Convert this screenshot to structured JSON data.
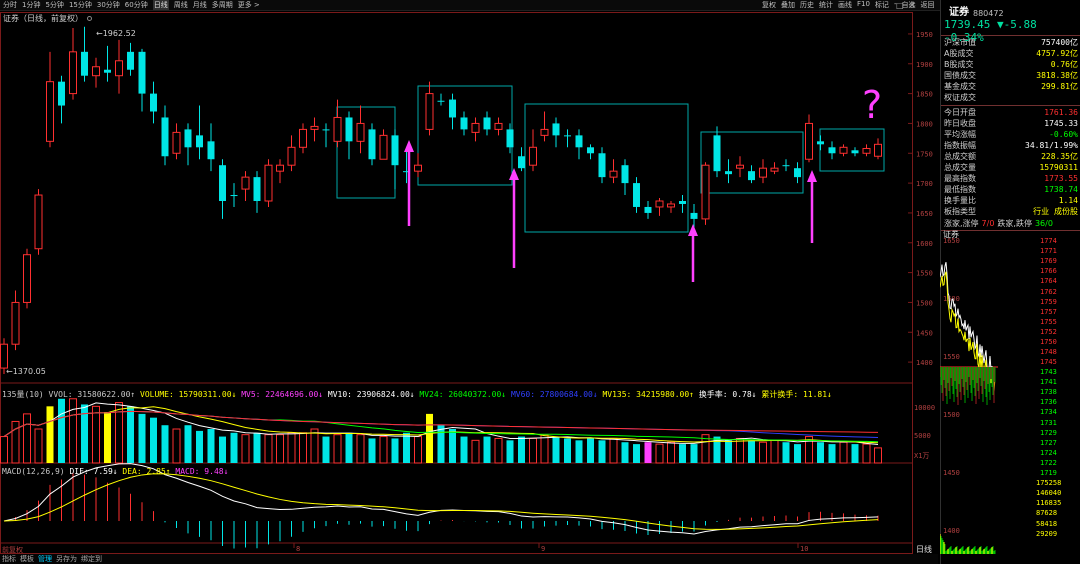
{
  "toolbar": {
    "periods": [
      "分时",
      "1分钟",
      "5分钟",
      "15分钟",
      "30分钟",
      "60分钟",
      "日线",
      "周线",
      "月线",
      "多周期",
      "更多 >"
    ],
    "active": "日线",
    "right": [
      "复权",
      "叠加",
      "历史",
      "统计",
      "画线",
      "F10",
      "标记",
      "-",
      "自选",
      "返回"
    ]
  },
  "chart": {
    "title": "证券（日线，前复权）",
    "high_label": "1962.52",
    "low_label": "1370.05",
    "price_axis": [
      "1950",
      "1900",
      "1850",
      "1800",
      "1750",
      "1700",
      "1650",
      "1600",
      "1550",
      "1500",
      "1450",
      "1400"
    ],
    "question_mark": "?",
    "x_labels": [
      "8",
      "9",
      "10"
    ],
    "bottom_label": "日线"
  },
  "colors": {
    "up": "#ff3030",
    "down": "#00e6e6",
    "box": "#00a8a8",
    "arrow": "#ff40ff",
    "ma5": "#ffffff",
    "ma10": "#ffff00",
    "ma24": "#00ff00",
    "ma60": "#3040ff",
    "ma135": "#ff3030"
  },
  "candles": [
    {
      "o": 1390,
      "c": 1430,
      "h": 1440,
      "l": 1380
    },
    {
      "o": 1430,
      "c": 1500,
      "h": 1520,
      "l": 1420
    },
    {
      "o": 1500,
      "c": 1580,
      "h": 1590,
      "l": 1490
    },
    {
      "o": 1590,
      "c": 1680,
      "h": 1690,
      "l": 1580
    },
    {
      "o": 1770,
      "c": 1870,
      "h": 1920,
      "l": 1760
    },
    {
      "o": 1870,
      "c": 1830,
      "h": 1880,
      "l": 1800
    },
    {
      "o": 1850,
      "c": 1920,
      "h": 1960,
      "l": 1840
    },
    {
      "o": 1920,
      "c": 1880,
      "h": 1962,
      "l": 1870
    },
    {
      "o": 1880,
      "c": 1895,
      "h": 1910,
      "l": 1860
    },
    {
      "o": 1890,
      "c": 1885,
      "h": 1930,
      "l": 1870
    },
    {
      "o": 1880,
      "c": 1905,
      "h": 1940,
      "l": 1850
    },
    {
      "o": 1920,
      "c": 1890,
      "h": 1935,
      "l": 1880
    },
    {
      "o": 1920,
      "c": 1850,
      "h": 1925,
      "l": 1820
    },
    {
      "o": 1850,
      "c": 1820,
      "h": 1870,
      "l": 1800
    },
    {
      "o": 1810,
      "c": 1745,
      "h": 1830,
      "l": 1730
    },
    {
      "o": 1750,
      "c": 1785,
      "h": 1800,
      "l": 1740
    },
    {
      "o": 1790,
      "c": 1760,
      "h": 1800,
      "l": 1730
    },
    {
      "o": 1780,
      "c": 1760,
      "h": 1830,
      "l": 1740
    },
    {
      "o": 1770,
      "c": 1740,
      "h": 1800,
      "l": 1720
    },
    {
      "o": 1730,
      "c": 1670,
      "h": 1740,
      "l": 1640
    },
    {
      "o": 1680,
      "c": 1680,
      "h": 1700,
      "l": 1660
    },
    {
      "o": 1690,
      "c": 1710,
      "h": 1720,
      "l": 1670
    },
    {
      "o": 1710,
      "c": 1670,
      "h": 1720,
      "l": 1650
    },
    {
      "o": 1670,
      "c": 1730,
      "h": 1740,
      "l": 1660
    },
    {
      "o": 1720,
      "c": 1730,
      "h": 1740,
      "l": 1700
    },
    {
      "o": 1730,
      "c": 1760,
      "h": 1780,
      "l": 1720
    },
    {
      "o": 1760,
      "c": 1790,
      "h": 1800,
      "l": 1750
    },
    {
      "o": 1790,
      "c": 1795,
      "h": 1810,
      "l": 1770
    },
    {
      "o": 1790,
      "c": 1790,
      "h": 1800,
      "l": 1760
    },
    {
      "o": 1770,
      "c": 1810,
      "h": 1840,
      "l": 1760
    },
    {
      "o": 1810,
      "c": 1770,
      "h": 1820,
      "l": 1740
    },
    {
      "o": 1770,
      "c": 1800,
      "h": 1830,
      "l": 1750
    },
    {
      "o": 1790,
      "c": 1740,
      "h": 1800,
      "l": 1730
    },
    {
      "o": 1740,
      "c": 1780,
      "h": 1790,
      "l": 1740
    },
    {
      "o": 1780,
      "c": 1730,
      "h": 1790,
      "l": 1690
    },
    {
      "o": 1720,
      "c": 1720,
      "h": 1760,
      "l": 1700
    },
    {
      "o": 1720,
      "c": 1730,
      "h": 1750,
      "l": 1710
    },
    {
      "o": 1790,
      "c": 1850,
      "h": 1870,
      "l": 1780
    },
    {
      "o": 1838,
      "c": 1838,
      "h": 1850,
      "l": 1830
    },
    {
      "o": 1840,
      "c": 1810,
      "h": 1850,
      "l": 1790
    },
    {
      "o": 1810,
      "c": 1790,
      "h": 1820,
      "l": 1780
    },
    {
      "o": 1785,
      "c": 1800,
      "h": 1810,
      "l": 1770
    },
    {
      "o": 1810,
      "c": 1790,
      "h": 1820,
      "l": 1780
    },
    {
      "o": 1790,
      "c": 1800,
      "h": 1810,
      "l": 1780
    },
    {
      "o": 1790,
      "c": 1760,
      "h": 1800,
      "l": 1750
    },
    {
      "o": 1745,
      "c": 1725,
      "h": 1760,
      "l": 1720
    },
    {
      "o": 1730,
      "c": 1760,
      "h": 1790,
      "l": 1720
    },
    {
      "o": 1780,
      "c": 1790,
      "h": 1820,
      "l": 1770
    },
    {
      "o": 1800,
      "c": 1780,
      "h": 1810,
      "l": 1760
    },
    {
      "o": 1780,
      "c": 1780,
      "h": 1790,
      "l": 1760
    },
    {
      "o": 1780,
      "c": 1760,
      "h": 1790,
      "l": 1740
    },
    {
      "o": 1760,
      "c": 1750,
      "h": 1765,
      "l": 1740
    },
    {
      "o": 1750,
      "c": 1710,
      "h": 1760,
      "l": 1700
    },
    {
      "o": 1710,
      "c": 1720,
      "h": 1740,
      "l": 1700
    },
    {
      "o": 1730,
      "c": 1700,
      "h": 1740,
      "l": 1680
    },
    {
      "o": 1700,
      "c": 1660,
      "h": 1710,
      "l": 1650
    },
    {
      "o": 1660,
      "c": 1650,
      "h": 1670,
      "l": 1640
    },
    {
      "o": 1660,
      "c": 1670,
      "h": 1675,
      "l": 1645
    },
    {
      "o": 1660,
      "c": 1665,
      "h": 1670,
      "l": 1650
    },
    {
      "o": 1670,
      "c": 1665,
      "h": 1680,
      "l": 1650
    },
    {
      "o": 1650,
      "c": 1640,
      "h": 1665,
      "l": 1620
    },
    {
      "o": 1640,
      "c": 1730,
      "h": 1735,
      "l": 1630
    },
    {
      "o": 1780,
      "c": 1720,
      "h": 1795,
      "l": 1710
    },
    {
      "o": 1720,
      "c": 1715,
      "h": 1740,
      "l": 1700
    },
    {
      "o": 1725,
      "c": 1730,
      "h": 1745,
      "l": 1710
    },
    {
      "o": 1720,
      "c": 1705,
      "h": 1730,
      "l": 1700
    },
    {
      "o": 1710,
      "c": 1725,
      "h": 1740,
      "l": 1700
    },
    {
      "o": 1720,
      "c": 1725,
      "h": 1735,
      "l": 1715
    },
    {
      "o": 1730,
      "c": 1730,
      "h": 1740,
      "l": 1720
    },
    {
      "o": 1725,
      "c": 1710,
      "h": 1735,
      "l": 1700
    },
    {
      "o": 1740,
      "c": 1800,
      "h": 1815,
      "l": 1735
    },
    {
      "o": 1770,
      "c": 1765,
      "h": 1780,
      "l": 1755
    },
    {
      "o": 1760,
      "c": 1750,
      "h": 1770,
      "l": 1740
    },
    {
      "o": 1750,
      "c": 1760,
      "h": 1765,
      "l": 1745
    },
    {
      "o": 1755,
      "c": 1750,
      "h": 1760,
      "l": 1745
    },
    {
      "o": 1750,
      "c": 1758,
      "h": 1765,
      "l": 1745
    },
    {
      "o": 1745,
      "c": 1765,
      "h": 1775,
      "l": 1740
    }
  ],
  "volume_bar": [
    {
      "t": "135量(10)",
      "c": "#c8c8c8"
    },
    {
      "t": " VVOL: 31580622.00↑",
      "c": "#c8c8c8"
    },
    {
      "t": " VOLUME: 15790311.00↓",
      "c": "#ffff00"
    },
    {
      "t": " MV5: 22464696.00↓",
      "c": "#ff40ff"
    },
    {
      "t": " MV10: 23906824.00↓",
      "c": "#ffffff"
    },
    {
      "t": " MV24: 26040372.00↓",
      "c": "#00ff00"
    },
    {
      "t": " MV60: 27800684.00↓",
      "c": "#3040ff"
    },
    {
      "t": " MV135: 34215980.00↑",
      "c": "#ffff00"
    },
    {
      "t": " 换手率: 0.78↓",
      "c": "#ffffff"
    },
    {
      "t": " 累计换手: 11.81↓",
      "c": "#ffff00"
    }
  ],
  "macd_bar": [
    {
      "t": "MACD(12,26,9)",
      "c": "#c8c8c8"
    },
    {
      "t": " DIF: 7.59↓",
      "c": "#ffffff"
    },
    {
      "t": " DEA: 2.85↑",
      "c": "#ffff00"
    },
    {
      "t": " MACD: 9.48↓",
      "c": "#ff40ff"
    }
  ],
  "volume_axis": [
    "10000",
    "5000",
    "X1万"
  ],
  "volumes": [
    14,
    22,
    26,
    18,
    30,
    34,
    34,
    31,
    30,
    27,
    32,
    30,
    26,
    24,
    20,
    18,
    20,
    17,
    18,
    14,
    16,
    15,
    16,
    15,
    15,
    16,
    16,
    18,
    14,
    15,
    16,
    15,
    13,
    14,
    13,
    16,
    14,
    26,
    20,
    18,
    14,
    12,
    14,
    13,
    12,
    14,
    13,
    15,
    14,
    13,
    12,
    13,
    12,
    13,
    11,
    10,
    11,
    10,
    11,
    10,
    10,
    15,
    14,
    12,
    13,
    12,
    11,
    12,
    11,
    10,
    14,
    11,
    10,
    11,
    10,
    10,
    8
  ],
  "side": {
    "name": "证券",
    "code": "880472",
    "price": "1739.45",
    "change": "▼-5.88",
    "pct": "-0.34%",
    "rows": [
      {
        "l": "沪深市值",
        "v": "757400亿",
        "c": "#ffffff"
      },
      {
        "l": "A股成交",
        "v": "4757.92亿",
        "c": "#ffff00"
      },
      {
        "l": "B股成交",
        "v": "0.76亿",
        "c": "#ffff00"
      },
      {
        "l": "国债成交",
        "v": "3818.38亿",
        "c": "#ffff00"
      },
      {
        "l": "基金成交",
        "v": "299.81亿",
        "c": "#ffff00"
      },
      {
        "l": "权证成交",
        "v": "",
        "c": "#ffff00"
      }
    ],
    "rows2": [
      {
        "l": "今日开盘",
        "v": "1761.36",
        "c": "#ff3030"
      },
      {
        "l": "昨日收盘",
        "v": "1745.33",
        "c": "#ffffff"
      },
      {
        "l": "平均涨幅",
        "v": "-0.60%",
        "c": "#00ff00"
      },
      {
        "l": "指数振幅",
        "v": "34.81/1.99%",
        "c": "#ffffff"
      },
      {
        "l": "总成交额",
        "v": "228.35亿",
        "c": "#ffff00"
      },
      {
        "l": "总成交量",
        "v": "15790311",
        "c": "#ffff00"
      },
      {
        "l": "最高指数",
        "v": "1773.55",
        "c": "#ff3030"
      },
      {
        "l": "最低指数",
        "v": "1738.74",
        "c": "#00ff00"
      },
      {
        "l": "换手量比",
        "v": "1.14",
        "c": "#ffff00"
      },
      {
        "l": "板指类型",
        "v": "行业  成份股",
        "c": "#ffff00"
      }
    ],
    "acct": [
      "涨家,涨停",
      "7/0",
      "跌家,跌停",
      "36/0"
    ],
    "mini_label": "证券",
    "mini_up": [
      "1774",
      "1771",
      "1769",
      "1766",
      "1764",
      "1762",
      "1759",
      "1757",
      "1755",
      "1752",
      "1750",
      "1748",
      "1745"
    ],
    "mini_down": [
      "1743",
      "1741",
      "1738",
      "1736",
      "1734",
      "1731",
      "1729",
      "1727",
      "1724",
      "1722",
      "1719",
      "175258",
      "146040",
      "116835",
      "87628",
      "58418",
      "29209"
    ],
    "mini_left": [
      "1650",
      "1600",
      "1550",
      "1500",
      "1450",
      "1400"
    ]
  },
  "bottom_tabs": [
    "指标",
    "模板",
    "管理",
    "另存为",
    "绑定到"
  ],
  "bottom_active": "管理",
  "left_label": "前复权"
}
